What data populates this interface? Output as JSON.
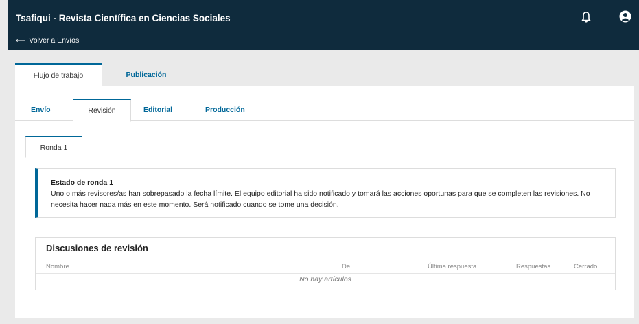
{
  "header": {
    "title": "Tsafiqui - Revista Científica en Ciencias Sociales",
    "back_arrow": "⟵",
    "back_label": "Volver a Envíos",
    "icons": [
      "bell-icon",
      "user-circle-icon"
    ],
    "background_color": "#0f2b3d"
  },
  "main_tabs": [
    {
      "label": "Flujo de trabajo",
      "active": true
    },
    {
      "label": "Publicación",
      "active": false
    }
  ],
  "sub_tabs": [
    {
      "label": "Envío",
      "active": false
    },
    {
      "label": "Revisión",
      "active": true
    },
    {
      "label": "Editorial",
      "active": false
    },
    {
      "label": "Producción",
      "active": false
    }
  ],
  "round_tab": {
    "label": "Ronda 1"
  },
  "notice": {
    "title": "Estado de ronda 1",
    "text": "Uno o más revisores/as han sobrepasado la fecha límite. El equipo editorial ha sido notificado y tomará las acciones oportunas para que se completen las revisiones. No necesita hacer nada más en este momento. Será notificado cuando se tome una decisión."
  },
  "discussions": {
    "title": "Discusiones de revisión",
    "columns": [
      "Nombre",
      "De",
      "Última respuesta",
      "Respuestas",
      "Cerrado"
    ],
    "empty_text": "No hay artículos"
  },
  "colors": {
    "accent": "#006798",
    "header": "#0f2b3d",
    "page_bg": "#eaeaea"
  }
}
